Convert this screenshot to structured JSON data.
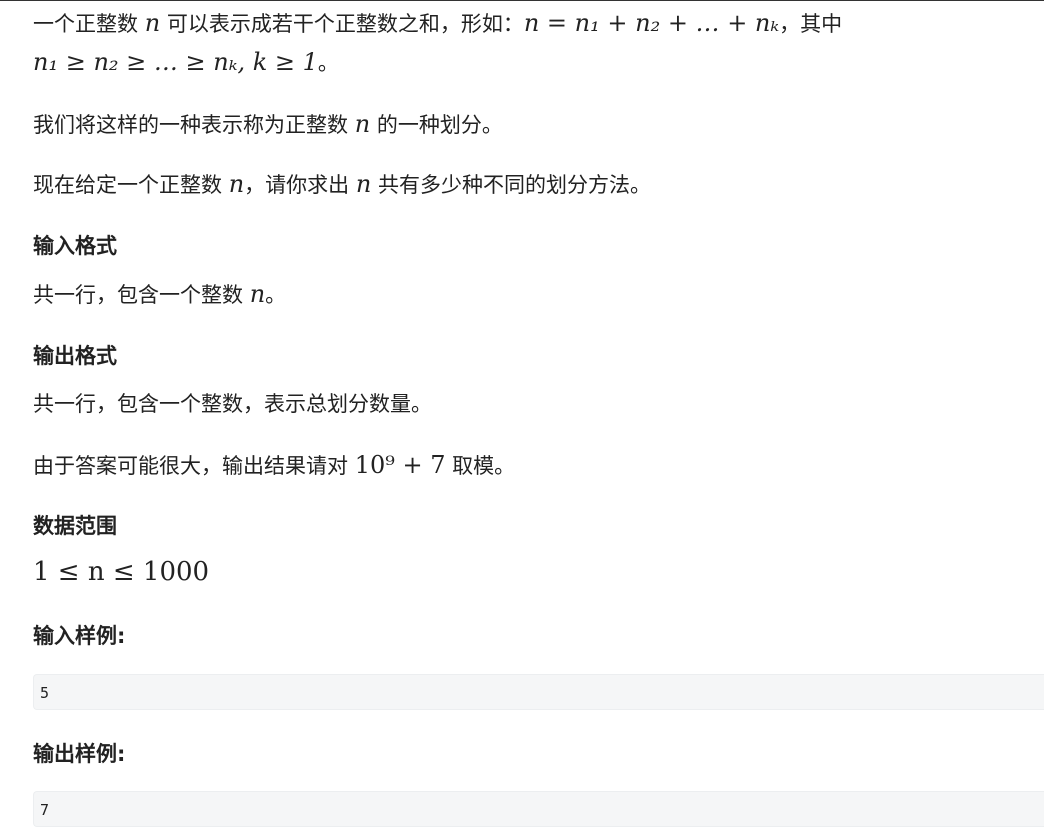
{
  "statement": {
    "line1_text": "一个正整数 ",
    "line1_var": "n",
    "line1_mid": " 可以表示成若干个正整数之和，形如：",
    "line1_formula": "n = n₁ + n₂ + … + nₖ",
    "line1_tail": "，其中",
    "line2_formula": "n₁ ≥ n₂ ≥ … ≥ nₖ, k ≥ 1",
    "line2_tail": "。",
    "para2_a": "我们将这样的一种表示称为正整数 ",
    "para2_var": "n",
    "para2_b": " 的一种划分。",
    "para3_a": "现在给定一个正整数 ",
    "para3_var1": "n",
    "para3_b": "，请你求出 ",
    "para3_var2": "n",
    "para3_c": " 共有多少种不同的划分方法。"
  },
  "input_format": {
    "heading": "输入格式",
    "text_a": "共一行，包含一个整数 ",
    "text_var": "n",
    "text_b": "。"
  },
  "output_format": {
    "heading": "输出格式",
    "text": "共一行，包含一个整数，表示总划分数量。",
    "mod_a": "由于答案可能很大，输出结果请对 ",
    "mod_formula": "10⁹ + 7",
    "mod_b": " 取模。"
  },
  "range": {
    "heading": "数据范围",
    "formula": "1 ≤ n ≤ 1000"
  },
  "sample_input": {
    "heading": "输入样例:",
    "value": "5"
  },
  "sample_output": {
    "heading": "输出样例:",
    "value": "7"
  }
}
